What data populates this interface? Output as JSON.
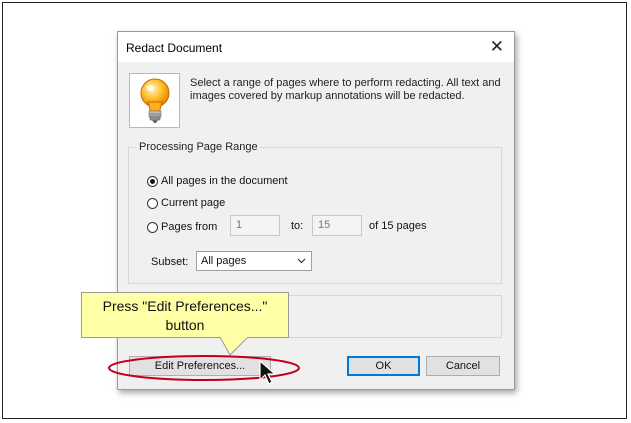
{
  "dialog": {
    "title": "Redact Document",
    "description": "Select a range of pages where to perform redacting. All text and images covered by markup annotations will be redacted.",
    "range_group": {
      "label": "Processing Page Range",
      "options": [
        "All pages in the document",
        "Current page",
        "Pages from"
      ],
      "selected": "All pages in the document",
      "from_value": "1",
      "to_label": "to:",
      "to_value": "15",
      "of_pages": "of 15 pages",
      "subset_label": "Subset:",
      "subset_value": "All pages"
    },
    "buttons": {
      "edit_preferences": "Edit Preferences...",
      "ok": "OK",
      "cancel": "Cancel"
    }
  },
  "callout": {
    "line1": "Press \"Edit Preferences...\"",
    "line2": "button"
  },
  "colors": {
    "callout_fill": "#ffffa5",
    "highlight_oval": "#c0001a",
    "default_button_border": "#0078d7"
  },
  "icons": [
    "lightbulb-icon",
    "close-icon",
    "chevron-down-icon",
    "mouse-cursor-icon"
  ]
}
